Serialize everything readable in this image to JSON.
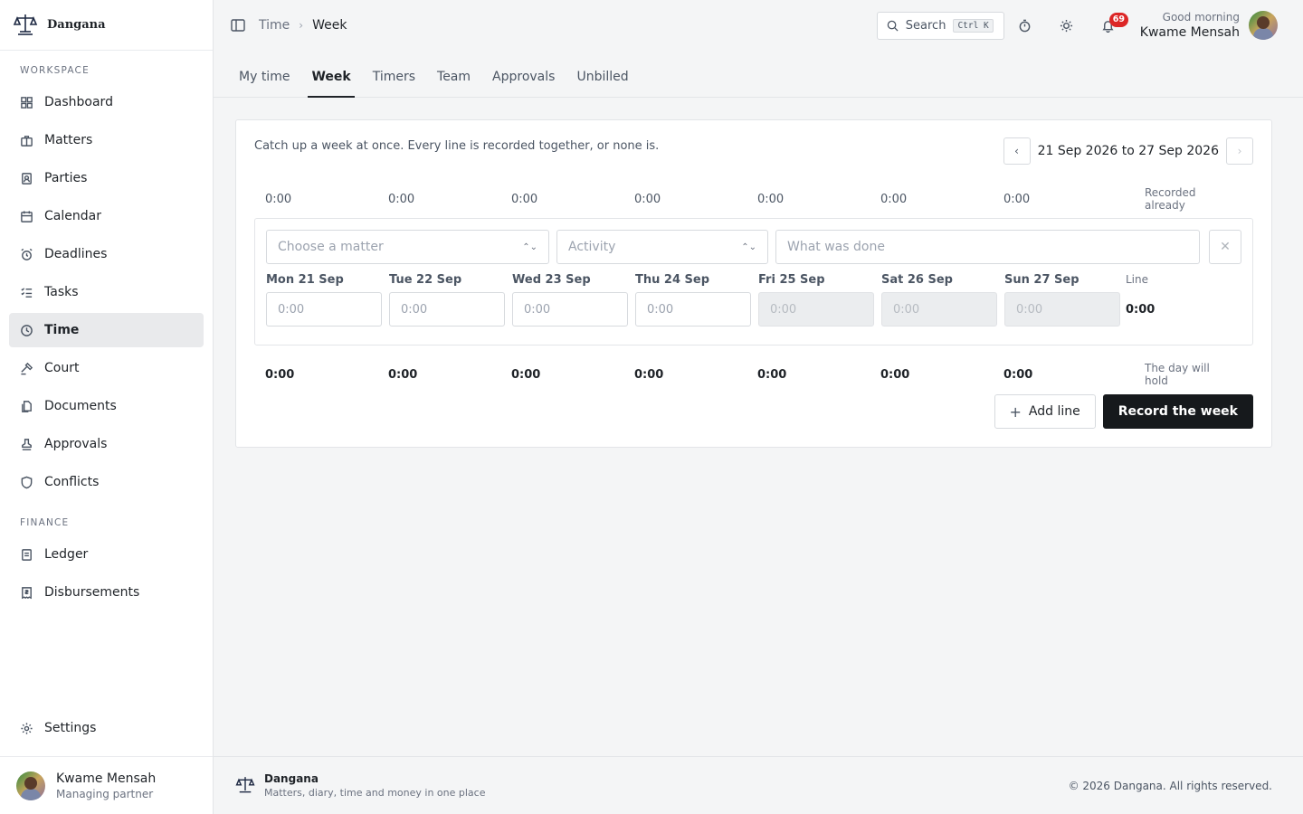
{
  "brand": {
    "name": "Dangana",
    "tagline": "Matters, diary, time and money in one place"
  },
  "sidebar": {
    "workspace_heading": "WORKSPACE",
    "finance_heading": "FINANCE",
    "workspace_items": [
      {
        "label": "Dashboard",
        "icon": "dashboard-icon"
      },
      {
        "label": "Matters",
        "icon": "briefcase-icon"
      },
      {
        "label": "Parties",
        "icon": "contact-icon"
      },
      {
        "label": "Calendar",
        "icon": "calendar-icon"
      },
      {
        "label": "Deadlines",
        "icon": "alarm-icon"
      },
      {
        "label": "Tasks",
        "icon": "checklist-icon"
      },
      {
        "label": "Time",
        "icon": "clock-icon",
        "active": true
      },
      {
        "label": "Court",
        "icon": "gavel-icon"
      },
      {
        "label": "Documents",
        "icon": "documents-icon"
      },
      {
        "label": "Approvals",
        "icon": "stamp-icon"
      },
      {
        "label": "Conflicts",
        "icon": "shield-icon"
      }
    ],
    "finance_items": [
      {
        "label": "Ledger",
        "icon": "ledger-icon"
      },
      {
        "label": "Disbursements",
        "icon": "receipt-icon"
      }
    ],
    "settings_label": "Settings",
    "user": {
      "name": "Kwame Mensah",
      "role": "Managing partner"
    }
  },
  "topbar": {
    "breadcrumb_parent": "Time",
    "breadcrumb_current": "Week",
    "search_label": "Search",
    "search_shortcut": "Ctrl K",
    "notification_count": "69",
    "greeting": "Good morning",
    "user_name": "Kwame Mensah"
  },
  "tabs": [
    {
      "label": "My time"
    },
    {
      "label": "Week",
      "active": true
    },
    {
      "label": "Timers"
    },
    {
      "label": "Team"
    },
    {
      "label": "Approvals"
    },
    {
      "label": "Unbilled"
    }
  ],
  "week": {
    "intro": "Catch up a week at once. Every line is recorded together, or none is.",
    "range": "21 Sep 2026 to 27 Sep 2026",
    "recorded_label": "Recorded already",
    "recorded": [
      "0:00",
      "0:00",
      "0:00",
      "0:00",
      "0:00",
      "0:00",
      "0:00"
    ],
    "line": {
      "matter_placeholder": "Choose a matter",
      "activity_placeholder": "Activity",
      "description_placeholder": "What was done",
      "days": [
        {
          "label": "Mon 21 Sep",
          "placeholder": "0:00",
          "disabled": false
        },
        {
          "label": "Tue 22 Sep",
          "placeholder": "0:00",
          "disabled": false
        },
        {
          "label": "Wed 23 Sep",
          "placeholder": "0:00",
          "disabled": false
        },
        {
          "label": "Thu 24 Sep",
          "placeholder": "0:00",
          "disabled": false
        },
        {
          "label": "Fri 25 Sep",
          "placeholder": "0:00",
          "disabled": true
        },
        {
          "label": "Sat 26 Sep",
          "placeholder": "0:00",
          "disabled": true
        },
        {
          "label": "Sun 27 Sep",
          "placeholder": "0:00",
          "disabled": true
        }
      ],
      "total_label": "Line",
      "total": "0:00"
    },
    "hold_label": "The day will hold",
    "hold": [
      "0:00",
      "0:00",
      "0:00",
      "0:00",
      "0:00",
      "0:00",
      "0:00"
    ],
    "add_line_label": "Add line",
    "record_label": "Record the week"
  },
  "footer": {
    "copyright": "© 2026 Dangana. All rights reserved."
  }
}
